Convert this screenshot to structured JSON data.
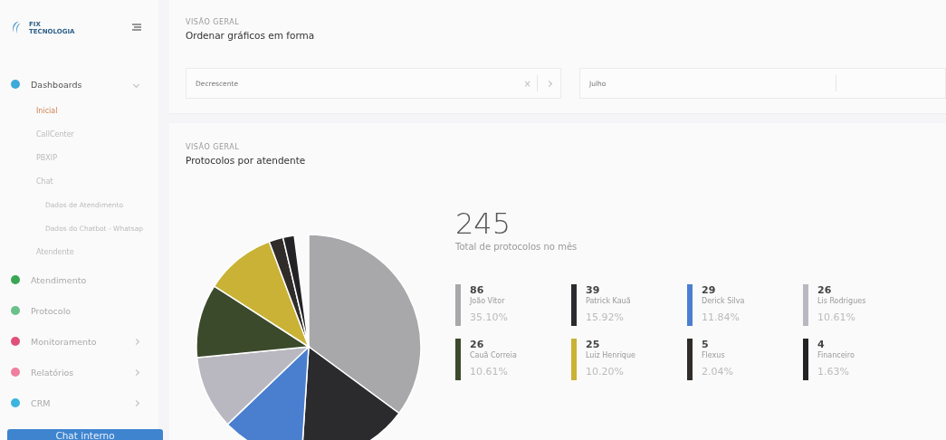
{
  "sidebar": {
    "logo": {
      "line_1": "FIX",
      "line_2": "TECNOLOGIA"
    },
    "items": [
      {
        "label": "Dashboards",
        "color": "#3fa9d9",
        "expanded": true,
        "selected": false,
        "children": [
          {
            "label": "Inicial",
            "selected": true
          },
          {
            "label": "CallCenter",
            "selected": false
          },
          {
            "label": "PBXIP",
            "selected": false
          },
          {
            "label": "Chat",
            "selected": false,
            "children": [
              {
                "label": "Dados de Atendimento",
                "selected": false
              },
              {
                "label": "Dados do Chatbot - Whatsap",
                "selected": false
              }
            ]
          },
          {
            "label": "Atendente",
            "selected": false
          }
        ]
      },
      {
        "label": "Atendimento",
        "color": "#3aa655",
        "selected": false
      },
      {
        "label": "Protocolo",
        "color": "#6cc08a",
        "selected": false
      },
      {
        "label": "Monitoramento",
        "color": "#e0507a",
        "expanded": false,
        "selected": false
      },
      {
        "label": "Relatórios",
        "color": "#ee7fa0",
        "expanded": false,
        "selected": false
      },
      {
        "label": "CRM",
        "color": "#3cb4e0",
        "expanded": false,
        "selected": false
      }
    ],
    "chat_button": "Chat interno"
  },
  "filter": {
    "overline": "VISÃO GERAL",
    "title": "Ordenar gráficos em forma",
    "order_value": "Decrescente",
    "clear_icon": "×",
    "month_value": "Julho"
  },
  "chart_card": {
    "overline": "VISÃO GERAL",
    "title": "Protocolos por atendente",
    "total": "245",
    "total_label": "Total de protocolos no mês",
    "chart_data": {
      "type": "pie",
      "values": [
        35.1,
        15.92,
        11.84,
        10.61,
        10.61,
        10.2,
        2.04,
        1.63
      ]
    },
    "legend": [
      {
        "value": "86",
        "name": "João Vitor",
        "percent": "35.10%",
        "color": "#a8a8ab"
      },
      {
        "value": "39",
        "name": "Patrick Kauã",
        "percent": "15.92%",
        "color": "#2b2b2e"
      },
      {
        "value": "29",
        "name": "Derick Silva",
        "percent": "11.84%",
        "color": "#4a7fd0"
      },
      {
        "value": "26",
        "name": "Lis Rodrigues",
        "percent": "10.61%",
        "color": "#b9b8c0"
      },
      {
        "value": "26",
        "name": "Cauã Correia",
        "percent": "10.61%",
        "color": "#3c4a2c"
      },
      {
        "value": "25",
        "name": "Luiz Henrique",
        "percent": "10.20%",
        "color": "#c9b236"
      },
      {
        "value": "5",
        "name": "Flexus",
        "percent": "2.04%",
        "color": "#2f2c29"
      },
      {
        "value": "4",
        "name": "Financeiro",
        "percent": "1.63%",
        "color": "#232326"
      }
    ]
  }
}
